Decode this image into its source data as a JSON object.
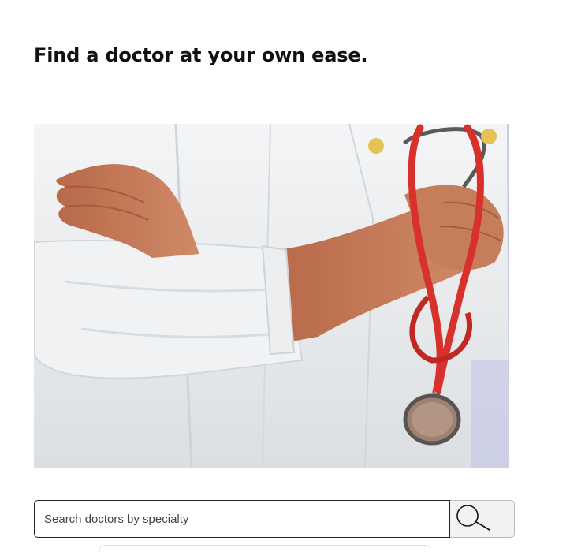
{
  "page": {
    "title": "Find a doctor at your own ease."
  },
  "hero": {
    "icon": "doctor-with-stethoscope-photo"
  },
  "search": {
    "placeholder": "Search doctors by specialty",
    "value": "",
    "button_icon": "search-icon"
  },
  "colors": {
    "title_text": "#111111",
    "coat": "#eef0f1",
    "stethoscope": "#d8302a",
    "search_button_bg": "#f2f2f2"
  }
}
